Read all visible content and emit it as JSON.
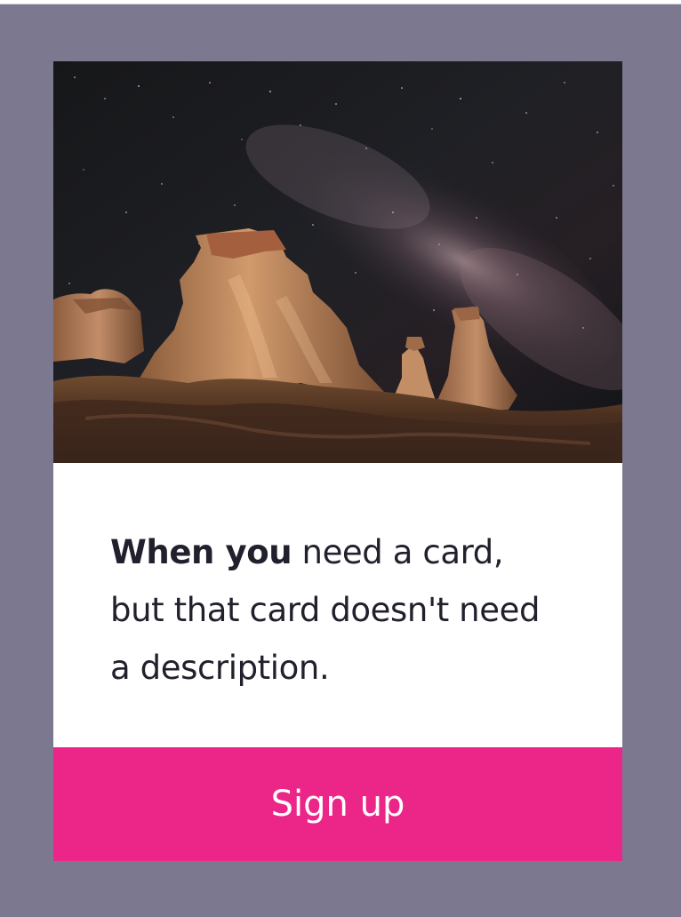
{
  "card": {
    "image_alt": "Rock formations under the night sky",
    "headline": {
      "bold_text": "When you",
      "regular_text": " need a card, but that card doesn't need a description."
    },
    "button_label": "Sign up"
  },
  "colors": {
    "page_background": "#7b788f",
    "card_background": "#ffffff",
    "button_background": "#ec2589",
    "headline_text": "#23202d",
    "button_text": "#ffffff"
  }
}
